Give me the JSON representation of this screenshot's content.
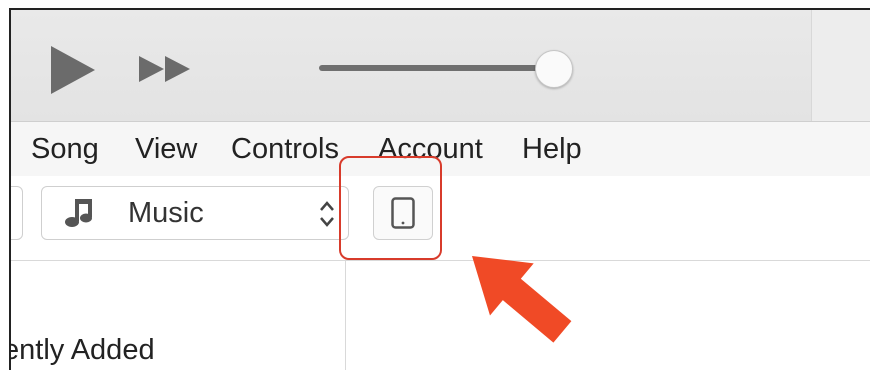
{
  "menu": {
    "items": [
      "Song",
      "View",
      "Controls",
      "Account",
      "Help"
    ]
  },
  "media_selector": {
    "label": "Music",
    "icon": "music-note-icon"
  },
  "device_button": {
    "icon": "ipad-device-icon"
  },
  "sidebar": {
    "visible_text": "ently Added"
  },
  "volume": {
    "level": 0.95
  },
  "colors": {
    "highlight": "#d83b2b",
    "arrow": "#f04a26"
  }
}
